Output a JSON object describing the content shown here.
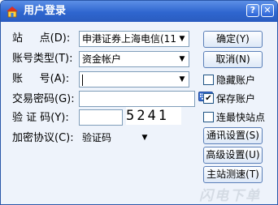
{
  "window": {
    "title": "用户登录",
    "help_glyph": "?",
    "close_glyph": "✕"
  },
  "form": {
    "site_label": "站     点(D):",
    "site_value": "申港证券上海电信(11",
    "account_type_label": "账号类型(T):",
    "account_type_value": "资金帐户",
    "account_label": "账     号(A):",
    "account_value": "",
    "password_label": "交易密码(G):",
    "password_value": "",
    "verify_label": "验 证 码(Y):",
    "verify_value": "",
    "captcha_text": "5241",
    "encrypt_label": "加密协议(C):",
    "encrypt_value": "验证码"
  },
  "buttons": {
    "ok": "确定(Y)",
    "cancel": "取消(N)",
    "comm_settings": "通讯设置(S)",
    "advanced_settings": "高级设置(U)",
    "speed_test": "主站测速(T)"
  },
  "checkboxes": {
    "hide_account": {
      "label": "隐藏账户",
      "checked": false
    },
    "save_account": {
      "label": "保存账户",
      "checked": true
    },
    "fastest_site": {
      "label": "连最快站点",
      "checked": false
    }
  },
  "watermark": "闪电下单",
  "colors": {
    "titlebar": "#2f66cf",
    "window_bg": "#eef3fb"
  }
}
